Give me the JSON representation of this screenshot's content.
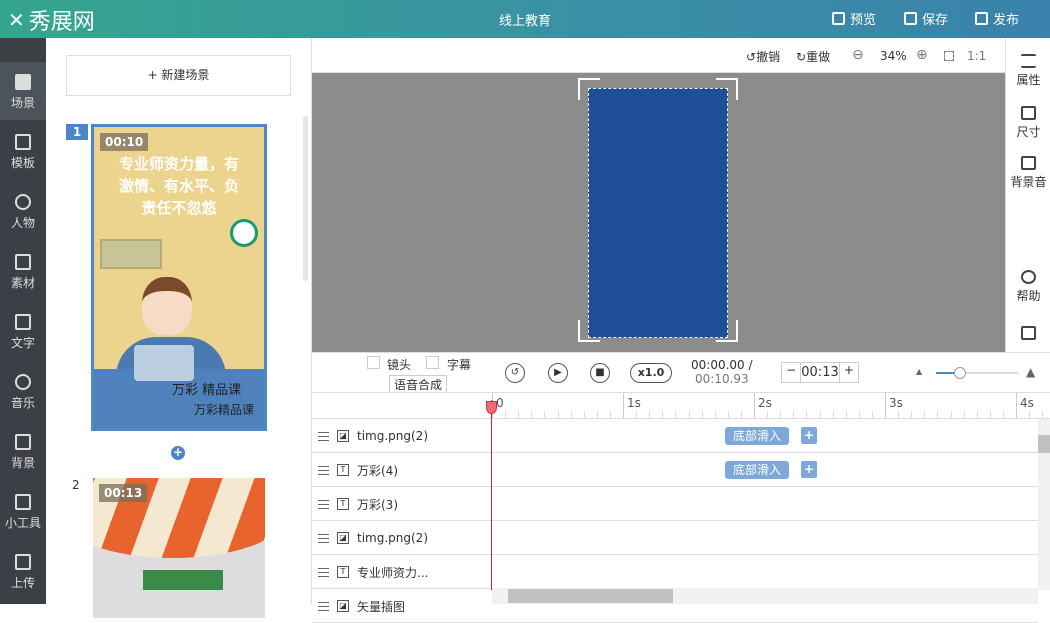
{
  "header": {
    "logo": "秀展网",
    "title": "线上教育",
    "preview": "预览",
    "save": "保存",
    "publish": "发布"
  },
  "leftbar": [
    {
      "label": "场景",
      "icon": "file-icon"
    },
    {
      "label": "模板",
      "icon": "template-icon"
    },
    {
      "label": "人物",
      "icon": "person-icon"
    },
    {
      "label": "素材",
      "icon": "grid-icon"
    },
    {
      "label": "文字",
      "icon": "text-icon"
    },
    {
      "label": "音乐",
      "icon": "music-icon"
    },
    {
      "label": "背景",
      "icon": "background-icon"
    },
    {
      "label": "小工具",
      "icon": "toolbox-icon"
    },
    {
      "label": "上传",
      "icon": "upload-icon"
    }
  ],
  "scenes": {
    "new_label": "+ 新建场景",
    "items": [
      {
        "num": "1",
        "time": "00:10",
        "text": "专业师资力量，有激情、有水平、负责任不忽悠",
        "brand1": "万彩 精品课",
        "brand2": "万彩精品课"
      },
      {
        "num": "2",
        "time": "00:13"
      }
    ]
  },
  "canvas": {
    "undo": "撤销",
    "redo": "重做",
    "zoom": "34%",
    "fit": "1:1",
    "bg": "#1e4e95"
  },
  "rightbar": {
    "props": "属性",
    "size": "尺寸",
    "bgm": "背景音",
    "help": "帮助"
  },
  "controls": {
    "lens": "镜头",
    "subtitle": "字幕",
    "tts": "语音合成",
    "speed": "x1.0",
    "current": "00:00.00 /",
    "total": "00:10.93",
    "duration": "00:13",
    "zoom_level": 0.12
  },
  "ruler": [
    "0",
    "1s",
    "2s",
    "3s",
    "4s"
  ],
  "tracks": [
    {
      "name": "timg.png(2)",
      "type": "image",
      "anim": "底部滑入"
    },
    {
      "name": "万彩(4)",
      "type": "text",
      "anim": "底部滑入"
    },
    {
      "name": "万彩(3)",
      "type": "text"
    },
    {
      "name": "timg.png(2)",
      "type": "image"
    },
    {
      "name": "专业师资力...",
      "type": "text"
    },
    {
      "name": "矢量插图",
      "type": "image"
    }
  ]
}
